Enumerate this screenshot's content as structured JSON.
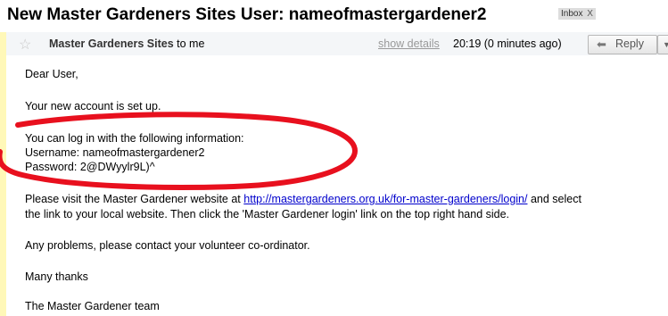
{
  "email": {
    "subject": "New Master Gardeners Sites User: nameofmastergardener2",
    "label": "Inbox",
    "label_remove": "X",
    "sender": "Master Gardeners Sites",
    "recipient": "to me",
    "show_details": "show details",
    "time": "20:19 (0 minutes ago)",
    "reply_label": "Reply",
    "body": {
      "greeting": "Dear User,",
      "setup_line": "Your new account is set up.",
      "login_intro": "You can log in with the following information:",
      "username_line": "Username: nameofmastergardener2",
      "password_line": "Password: 2@DWyylr9L)^",
      "visit_prefix": "Please visit the Master Gardener website at",
      "visit_link": "http://mastergardeners.org.uk/for-master-gardeners/login/",
      "visit_suffix": "and select",
      "visit_line2": "the link to your local website. Then click the 'Master Gardener login' link on the top right hand side.",
      "problems": "Any problems, please contact your volunteer co-ordinator.",
      "thanks": "Many thanks",
      "signature": "The Master Gardener team"
    }
  },
  "colors": {
    "annotation_oval": "#e8101e",
    "link": "#0000cc",
    "header_bg": "#f4f6f8",
    "left_strip": "#fff8b8"
  }
}
